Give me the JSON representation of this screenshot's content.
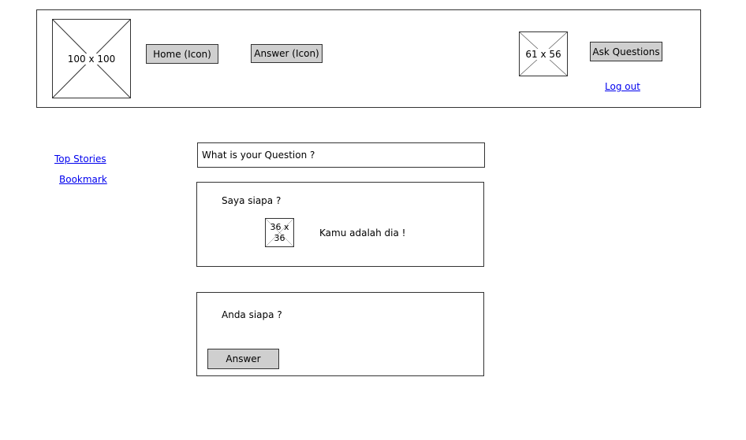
{
  "header": {
    "logo_placeholder": "100 x 100",
    "home_button": "Home (Icon)",
    "answer_button": "Answer (Icon)",
    "avatar_placeholder": "61 x 56",
    "ask_button": "Ask Questions",
    "logout_link": "Log out"
  },
  "sidebar": {
    "items": [
      "Top Stories",
      "Bookmark"
    ]
  },
  "question_input": {
    "placeholder": "What is your Question ?"
  },
  "feed": [
    {
      "question": "Saya siapa ?",
      "thumbnail": "36 x 36",
      "answer": "Kamu adalah dia !"
    },
    {
      "question": "Anda siapa ?",
      "answer_button": "Answer"
    }
  ]
}
